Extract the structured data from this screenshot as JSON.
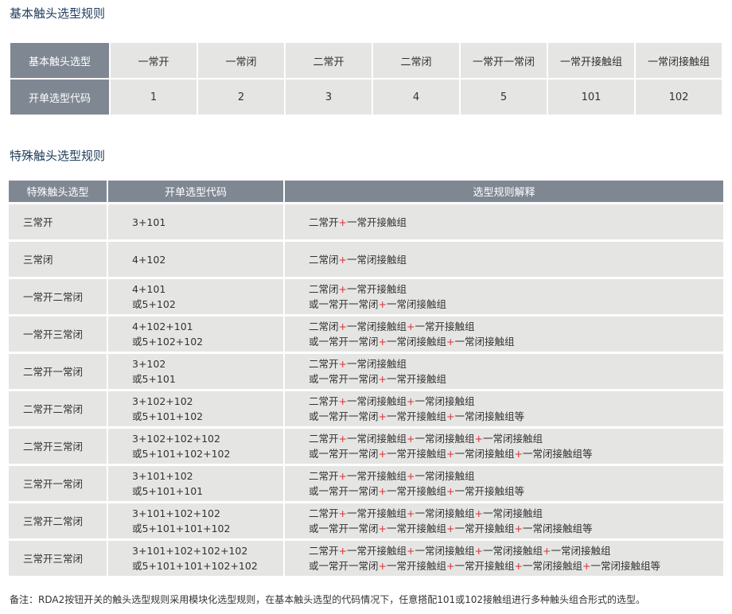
{
  "basic_section": {
    "title": "基本触头选型规则",
    "row1_header": "基本触头选型",
    "row2_header": "开单选型代码",
    "types": [
      "一常开",
      "一常闭",
      "二常开",
      "二常闭",
      "一常开一常闭",
      "一常开接触组",
      "一常闭接触组"
    ],
    "codes": [
      "1",
      "2",
      "3",
      "4",
      "5",
      "101",
      "102"
    ]
  },
  "special_section": {
    "title": "特殊触头选型规则",
    "headers": [
      "特殊触头选型",
      "开单选型代码",
      "选型规则解释"
    ],
    "rows": [
      {
        "name": "三常开",
        "codes": [
          "3+101"
        ],
        "expl": [
          [
            "二常开",
            "一常开接触组"
          ]
        ]
      },
      {
        "name": "三常闭",
        "codes": [
          "4+102"
        ],
        "expl": [
          [
            "二常闭",
            "一常闭接触组"
          ]
        ]
      },
      {
        "name": "一常开二常闭",
        "codes": [
          "4+101",
          "或5+102"
        ],
        "expl": [
          [
            "二常闭",
            "一常开接触组"
          ],
          [
            "或一常开一常闭",
            "一常闭接触组"
          ]
        ]
      },
      {
        "name": "一常开三常闭",
        "codes": [
          "4+102+101",
          "或5+102+102"
        ],
        "expl": [
          [
            "二常闭",
            "一常闭接触组",
            "一常开接触组"
          ],
          [
            "或一常开一常闭",
            "一常闭接触组",
            "一常闭接触组"
          ]
        ]
      },
      {
        "name": "二常开一常闭",
        "codes": [
          "3+102",
          "或5+101"
        ],
        "expl": [
          [
            "二常开",
            "一常闭接触组"
          ],
          [
            "或一常开一常闭",
            "一常开接触组"
          ]
        ]
      },
      {
        "name": "二常开二常闭",
        "codes": [
          "3+102+102",
          "或5+101+102"
        ],
        "expl": [
          [
            "二常开",
            "一常闭接触组",
            "一常闭接触组"
          ],
          [
            "或一常开一常闭",
            "一常开接触组",
            "一常闭接触组等"
          ]
        ]
      },
      {
        "name": "二常开三常闭",
        "codes": [
          "3+102+102+102",
          "或5+101+102+102"
        ],
        "expl": [
          [
            "二常开",
            "一常闭接触组",
            "一常闭接触组",
            "一常闭接触组"
          ],
          [
            "或一常开一常闭",
            "一常开接触组",
            "一常闭接触组",
            "一常闭接触组等"
          ]
        ]
      },
      {
        "name": "三常开一常闭",
        "codes": [
          "3+101+102",
          "或5+101+101"
        ],
        "expl": [
          [
            "二常开",
            "一常开接触组",
            "一常闭接触组"
          ],
          [
            "或一常开一常闭",
            "一常开接触组",
            "一常开接触组等"
          ]
        ]
      },
      {
        "name": "三常开二常闭",
        "codes": [
          "3+101+102+102",
          "或5+101+101+102"
        ],
        "expl": [
          [
            "二常开",
            "一常开接触组",
            "一常闭接触组",
            "一常闭接触组"
          ],
          [
            "或一常开一常闭",
            "一常开接触组",
            "一常开接触组",
            "一常闭接触组等"
          ]
        ]
      },
      {
        "name": "三常开三常闭",
        "codes": [
          "3+101+102+102+102",
          "或5+101+101+102+102"
        ],
        "expl": [
          [
            "二常开",
            "一常开接触组",
            "一常闭接触组",
            "一常闭接触组",
            "一常闭接触组"
          ],
          [
            "或一常开一常闭",
            "一常开接触组",
            "一常开接触组",
            "一常闭接触组",
            "一常闭接触组等"
          ]
        ]
      }
    ]
  },
  "note": "备注：RDA2按钮开关的触头选型规则采用模块化选型规则，在基本触头选型的代码情况下，任意搭配101或102接触组进行多种触头组合形式的选型。"
}
